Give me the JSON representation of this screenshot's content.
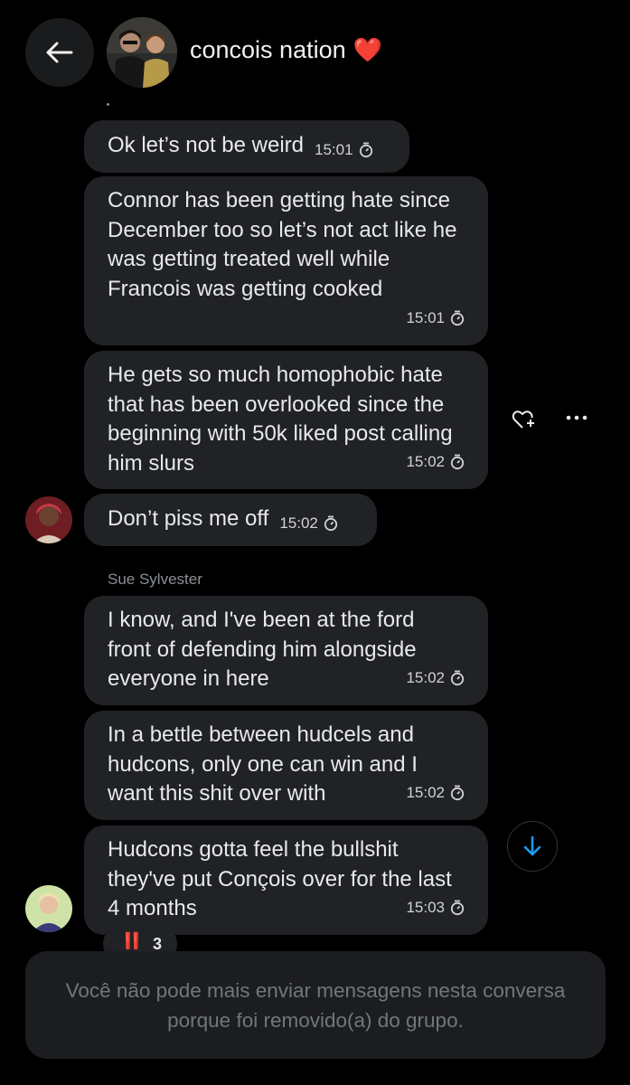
{
  "header": {
    "title": "concois nation",
    "title_emoji": "❤️",
    "back_icon": "arrow-left-icon",
    "avatar_icon": "group-avatar"
  },
  "messages": [
    {
      "text": "Ok let’s not be weird",
      "time": "15:01"
    },
    {
      "text": "Connor has been getting hate since December too so let’s not act like he was getting treated well while Francois was getting cooked",
      "time": "15:01"
    },
    {
      "text": "He gets so much homophobic hate that has been overlooked since the beginning with 50k liked post calling him slurs",
      "time": "15:02"
    },
    {
      "text": "Don’t piss me off",
      "time": "15:02"
    },
    {
      "sender": "Sue Sylvester",
      "text": "I know, and I've been at the ford front of defending him alongside everyone in here",
      "time": "15:02"
    },
    {
      "text": "In a bettle between hudcels and hudcons, only one can win and I want this shit over with",
      "time": "15:02"
    },
    {
      "text": "Hudcons gotta feel the bullshit they've put Conçois over for the last 4 months",
      "time": "15:03"
    }
  ],
  "reaction": {
    "emoji": "‼️",
    "count": "3"
  },
  "notice": "Você não pode mais enviar mensagens nesta conversa porque foi removido(a) do grupo.",
  "icons": {
    "react": "heart-plus-icon",
    "more": "more-horizontal-icon",
    "scroll_down": "arrow-down-icon",
    "timer": "timer-icon"
  },
  "colors": {
    "bubble": "#212225",
    "background": "#000000",
    "accent": "#1d9bf0",
    "notice_text": "#72767b"
  }
}
